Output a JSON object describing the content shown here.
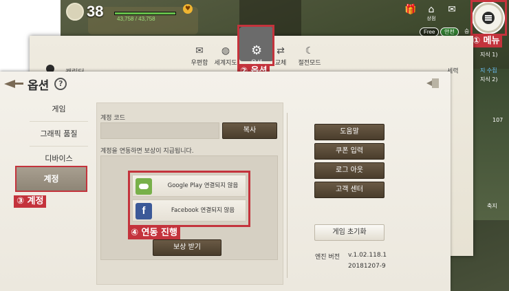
{
  "hud": {
    "level": "38",
    "hp_text": "43,758 / 43,758",
    "hp_fraction": 1.0,
    "shop_label": "상점",
    "free_badge": "Free",
    "safe_badge": "안전",
    "auto_prefix": "승"
  },
  "menu_layer": {
    "items": [
      {
        "label": "우편함",
        "icon": "mail-icon"
      },
      {
        "label": "세계지도",
        "icon": "globe-icon"
      },
      {
        "label": "옵션",
        "icon": "gear-icon"
      },
      {
        "label": "교체",
        "icon": "swap-user-icon"
      },
      {
        "label": "절전모드",
        "icon": "power-save-icon"
      }
    ],
    "character_label": "캐릭터",
    "right_label": "세력"
  },
  "quests": {
    "line1": "지식 1)",
    "line2": "지 수집",
    "line3": "지식 2)",
    "counter": "107",
    "button": "축지"
  },
  "options": {
    "title": "옵션",
    "help": "?",
    "nav": [
      "게임",
      "그래픽 품질",
      "디바이스",
      "계정"
    ],
    "active_nav": "계정",
    "account_code_label": "계정 코드",
    "account_code_value": "",
    "copy_button": "복사",
    "link_notice": "계정을 연동하면 보상이 지급됩니다.",
    "links": [
      {
        "icon": "google-play-games-icon",
        "label": "Google Play 연결되지 않음"
      },
      {
        "icon": "facebook-icon",
        "label": "Facebook 연결되지 않음"
      }
    ],
    "reward_button": "보상 받기",
    "side_buttons": [
      "도움말",
      "쿠폰 입력",
      "로그 아웃",
      "고객 센터"
    ],
    "reset_button": "게임 초기화",
    "engine_label": "엔진 버전",
    "engine_version": "v.1.02.118.1",
    "build": "20181207-9"
  },
  "annotations": {
    "step1": "① 메뉴",
    "step2": "② 옵션",
    "step3": "③ 계정",
    "step4": "④ 연동 진행",
    "color": "#c4333c"
  }
}
